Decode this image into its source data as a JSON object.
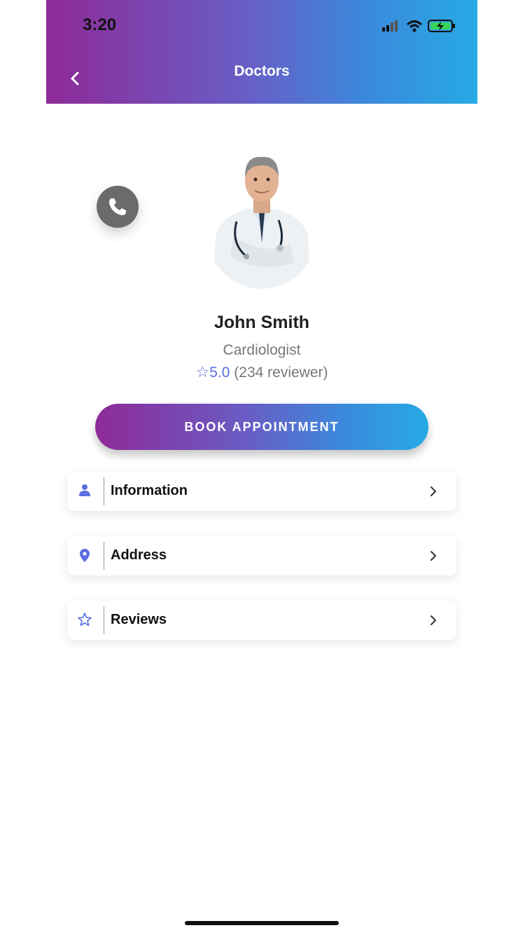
{
  "status_bar": {
    "time": "3:20"
  },
  "nav": {
    "title": "Doctors"
  },
  "doctor": {
    "name": "John Smith",
    "specialty": "Cardiologist",
    "rating": "5.0",
    "reviews": "(234 reviewer)"
  },
  "actions": {
    "book_label": "BOOK APPOINTMENT"
  },
  "menu": [
    {
      "label": "Information",
      "icon": "person-icon"
    },
    {
      "label": "Address",
      "icon": "location-pin-icon"
    },
    {
      "label": "Reviews",
      "icon": "star-outline-icon"
    }
  ],
  "colors": {
    "gradient_start": "#8e2a98",
    "gradient_end": "#27aae4",
    "accent": "#5a6ee0",
    "call_button": "#6b6b6b"
  }
}
